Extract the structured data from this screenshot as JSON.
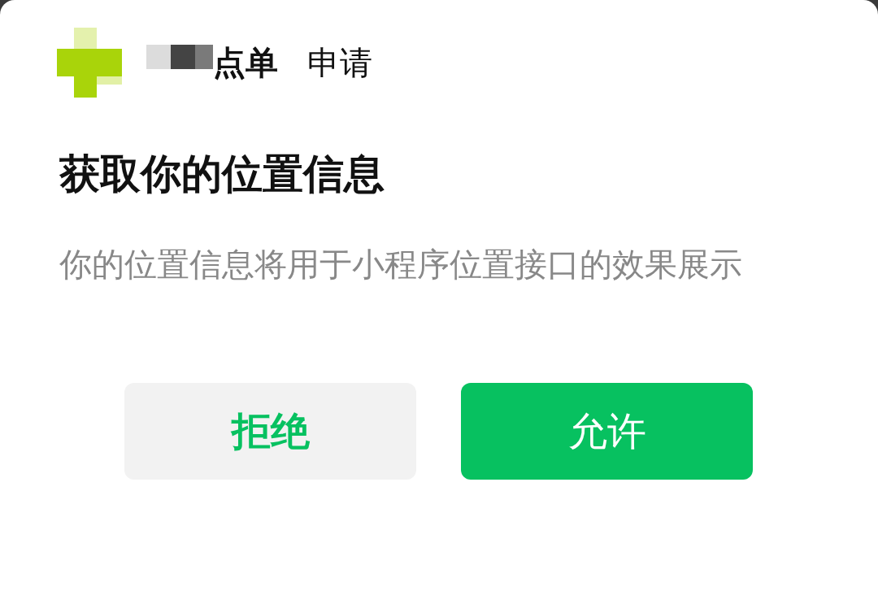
{
  "header": {
    "app_name": "点单",
    "action": "申请"
  },
  "title": "获取你的位置信息",
  "description": "你的位置信息将用于小程序位置接口的效果展示",
  "buttons": [
    {
      "label": "拒绝",
      "kind": "secondary"
    },
    {
      "label": "允许",
      "kind": "primary"
    }
  ]
}
